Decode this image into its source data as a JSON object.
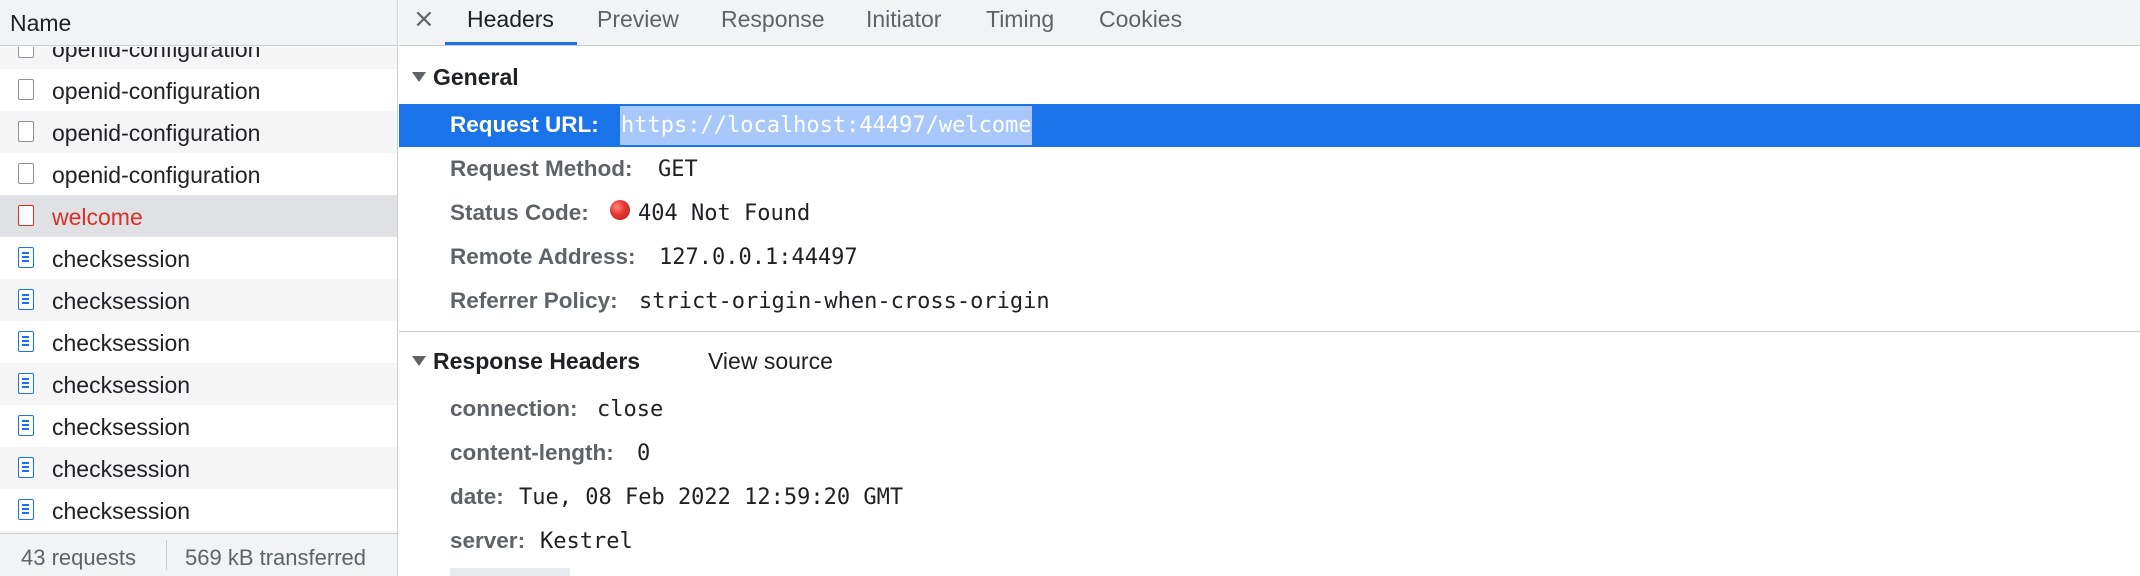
{
  "request_list": {
    "header": "Name",
    "rows": [
      {
        "label": "openid-configuration",
        "type": "plain"
      },
      {
        "label": "openid-configuration",
        "type": "plain"
      },
      {
        "label": "openid-configuration",
        "type": "plain"
      },
      {
        "label": "openid-configuration",
        "type": "plain"
      },
      {
        "label": "welcome",
        "type": "error",
        "selected": true
      },
      {
        "label": "checksession",
        "type": "doc"
      },
      {
        "label": "checksession",
        "type": "doc"
      },
      {
        "label": "checksession",
        "type": "doc"
      },
      {
        "label": "checksession",
        "type": "doc"
      },
      {
        "label": "checksession",
        "type": "doc"
      },
      {
        "label": "checksession",
        "type": "doc"
      },
      {
        "label": "checksession",
        "type": "doc"
      },
      {
        "label": "checksession",
        "type": "doc"
      }
    ],
    "footer": {
      "requests": "43 requests",
      "transferred": "569 kB transferred"
    }
  },
  "tabs": {
    "close": "×",
    "items": [
      "Headers",
      "Preview",
      "Response",
      "Initiator",
      "Timing",
      "Cookies"
    ],
    "active": "Headers"
  },
  "general": {
    "title": "General",
    "request_url_key": "Request URL:",
    "request_url": "https://localhost:44497/welcome",
    "request_method_key": "Request Method:",
    "request_method": "GET",
    "status_code_key": "Status Code:",
    "status_code": "404 Not Found",
    "status_color": "#e53935",
    "remote_address_key": "Remote Address:",
    "remote_address": "127.0.0.1:44497",
    "referrer_policy_key": "Referrer Policy:",
    "referrer_policy": "strict-origin-when-cross-origin"
  },
  "response_headers": {
    "title": "Response Headers",
    "view_source": "View source",
    "items": [
      {
        "key": "connection:",
        "value": "close"
      },
      {
        "key": "content-length:",
        "value": "0"
      },
      {
        "key": "date:",
        "value": "Tue, 08 Feb 2022 12:59:20 GMT"
      },
      {
        "key": "server:",
        "value": "Kestrel"
      }
    ]
  },
  "colors": {
    "accent": "#1a73e8",
    "error": "#d93025"
  }
}
